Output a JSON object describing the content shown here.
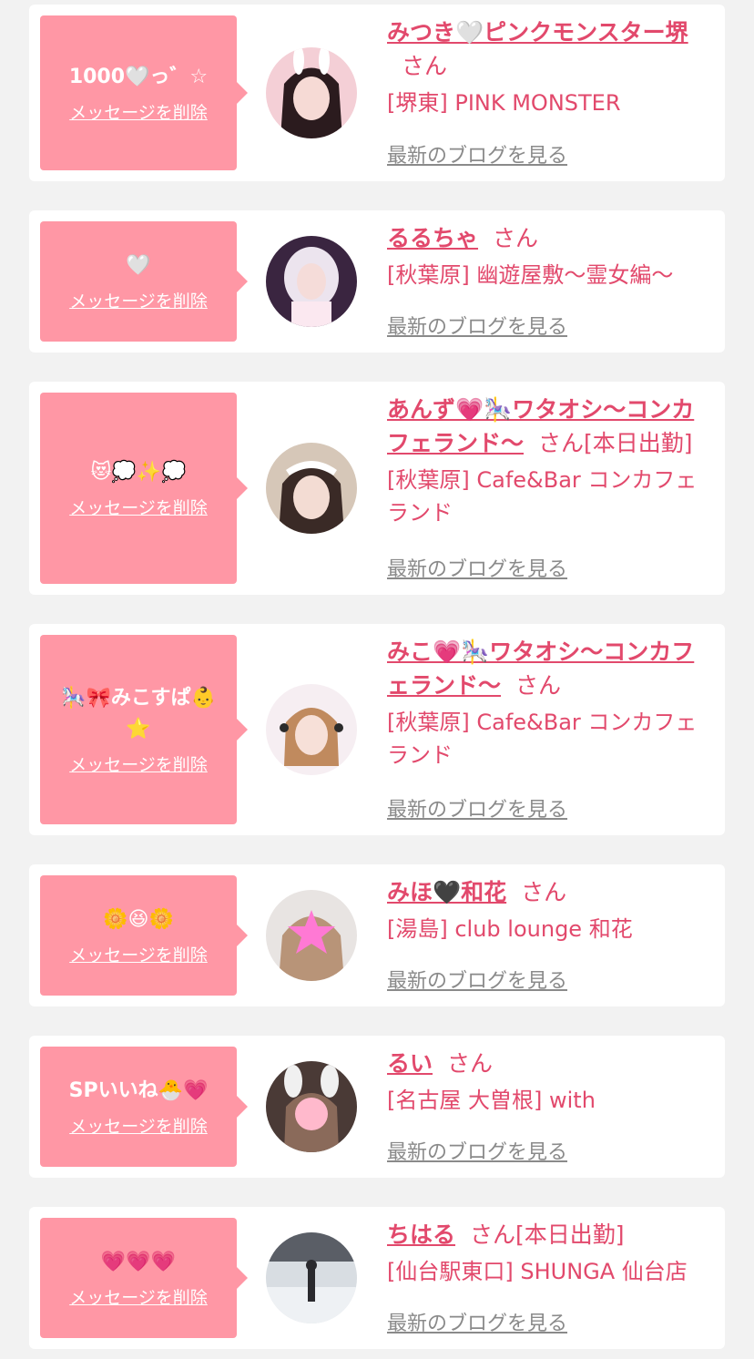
{
  "entries": [
    {
      "message": "1000🤍っ゛☆",
      "delete_label": "メッセージを削除",
      "name": "みつき🤍ピンクモンスター堺",
      "honorific": "さん",
      "working": "",
      "shop": "[堺東] PINK MONSTER",
      "blog_label": "最新のブログを見る"
    },
    {
      "message": "🤍",
      "delete_label": "メッセージを削除",
      "name": "るるちゃ",
      "honorific": "さん",
      "working": "",
      "shop": "[秋葉原] 幽遊屋敷〜霊女編〜",
      "blog_label": "最新のブログを見る"
    },
    {
      "message": "😻💭✨💭",
      "delete_label": "メッセージを削除",
      "name": "あんず💗🎠ワタオシ〜コンカフェランド〜",
      "honorific": "さん",
      "working": "[本日出勤]",
      "shop": "[秋葉原] Cafe&Bar コンカフェランド",
      "blog_label": "最新のブログを見る"
    },
    {
      "message": "🎠🎀みこすぱ👶⭐",
      "delete_label": "メッセージを削除",
      "name": "みこ💗🎠ワタオシ〜コンカフェランド〜",
      "honorific": "さん",
      "working": "",
      "shop": "[秋葉原] Cafe&Bar コンカフェランド",
      "blog_label": "最新のブログを見る"
    },
    {
      "message": "🌼😆🌼",
      "delete_label": "メッセージを削除",
      "name": "みほ🖤和花",
      "honorific": "さん",
      "working": "",
      "shop": "[湯島] club lounge 和花",
      "blog_label": "最新のブログを見る"
    },
    {
      "message": "SPいいね🐣💗",
      "delete_label": "メッセージを削除",
      "name": "るい",
      "honorific": "さん",
      "working": "",
      "shop": "[名古屋 大曽根] with",
      "blog_label": "最新のブログを見る"
    },
    {
      "message": "💗💗💗",
      "delete_label": "メッセージを削除",
      "name": "ちはる",
      "honorific": "さん",
      "working": "[本日出勤]",
      "shop": "[仙台駅東口] SHUNGA 仙台店",
      "blog_label": "最新のブログを見る"
    }
  ],
  "colors": {
    "bubble": "#ff97a5",
    "accent": "#e2496c",
    "link_gray": "#8a8a8a",
    "background": "#f2f2f2"
  }
}
